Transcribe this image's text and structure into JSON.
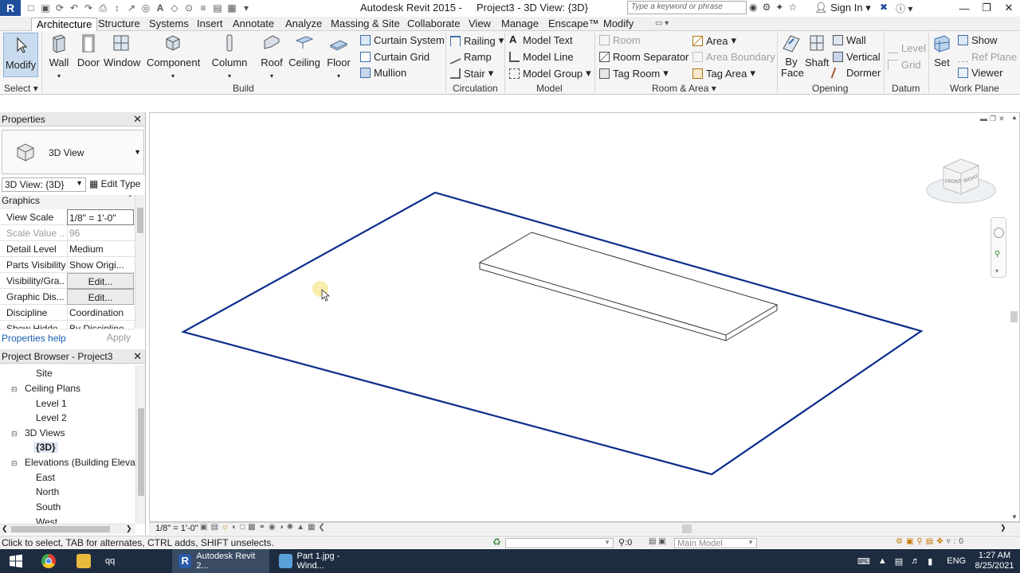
{
  "titlebar": {
    "app_logo": "R",
    "title": "Autodesk Revit 2015 -     Project3 - 3D View: {3D}",
    "search_placeholder": "Type a keyword or phrase",
    "signin_label": "Sign In"
  },
  "tabs": [
    "Architecture",
    "Structure",
    "Systems",
    "Insert",
    "Annotate",
    "Analyze",
    "Massing & Site",
    "Collaborate",
    "View",
    "Manage",
    "Enscape™",
    "Modify"
  ],
  "active_tab": "Architecture",
  "ribbon": {
    "select_label": "Select",
    "modify_label": "Modify",
    "build": {
      "panel_label": "Build",
      "large": [
        "Wall",
        "Door",
        "Window",
        "Component",
        "Column",
        "Roof",
        "Ceiling",
        "Floor"
      ],
      "small": [
        "Curtain System",
        "Curtain Grid",
        "Mullion"
      ]
    },
    "circulation": {
      "panel_label": "Circulation",
      "items": [
        "Railing",
        "Ramp",
        "Stair"
      ]
    },
    "model": {
      "panel_label": "Model",
      "items": [
        "Model Text",
        "Model Line",
        "Model Group"
      ]
    },
    "room_area": {
      "panel_label": "Room & Area",
      "col1": [
        "Room",
        "Room Separator",
        "Tag Room"
      ],
      "col2": [
        "Area",
        "Area Boundary",
        "Tag Area"
      ]
    },
    "opening": {
      "panel_label": "Opening",
      "large": [
        "By Face",
        "Shaft"
      ],
      "small": [
        "Wall",
        "Vertical",
        "Dormer"
      ]
    },
    "datum": {
      "panel_label": "Datum",
      "items": [
        "Level",
        "Grid"
      ]
    },
    "work_plane": {
      "panel_label": "Work Plane",
      "set_label": "Set",
      "items": [
        "Show",
        "Ref Plane",
        "Viewer"
      ]
    }
  },
  "properties": {
    "title": "Properties",
    "type_name": "3D View",
    "instance_selector": "3D View: {3D}",
    "edit_type_label": "Edit Type",
    "group_label": "Graphics",
    "rows": [
      {
        "key": "View Scale",
        "value": "1/8\" = 1'-0\""
      },
      {
        "key": "Scale Value ...",
        "value": "96"
      },
      {
        "key": "Detail Level",
        "value": "Medium"
      },
      {
        "key": "Parts Visibility",
        "value": "Show Origi..."
      },
      {
        "key": "Visibility/Gra...",
        "value": "Edit..."
      },
      {
        "key": "Graphic Dis...",
        "value": "Edit..."
      },
      {
        "key": "Discipline",
        "value": "Coordination"
      },
      {
        "key": "Show Hidde...",
        "value": "By Discipline"
      }
    ],
    "help_link": "Properties help",
    "apply_label": "Apply"
  },
  "project_browser": {
    "title": "Project Browser - Project3",
    "items": [
      {
        "label": "Site",
        "level": 2
      },
      {
        "label": "Ceiling Plans",
        "level": 1
      },
      {
        "label": "Level 1",
        "level": 2
      },
      {
        "label": "Level 2",
        "level": 2
      },
      {
        "label": "3D Views",
        "level": 1
      },
      {
        "label": "{3D}",
        "level": 2
      },
      {
        "label": "Elevations (Building Elevati",
        "level": 1
      },
      {
        "label": "East",
        "level": 2
      },
      {
        "label": "North",
        "level": 2
      },
      {
        "label": "South",
        "level": 2
      },
      {
        "label": "West",
        "level": 2
      }
    ]
  },
  "viewcube": {
    "front_label": "FRONT",
    "right_label": "RIGHT"
  },
  "view_control": {
    "scale": "1/8\" = 1'-0\""
  },
  "status": {
    "text": "Click to select, TAB for alternates, CTRL adds, SHIFT unselects.",
    "selection_count": ":0",
    "model_label": "Main Model"
  },
  "taskbar": {
    "items": [
      "qq",
      "Autodesk Revit 2...",
      "Part 1.jpg - Wind..."
    ],
    "language": "ENG",
    "time": "1:27 AM",
    "date": "8/25/2021"
  },
  "colors": {
    "accent": "#1f4e9b",
    "boundary_line": "#0b2c8c",
    "taskbar": "#1d2c40"
  }
}
